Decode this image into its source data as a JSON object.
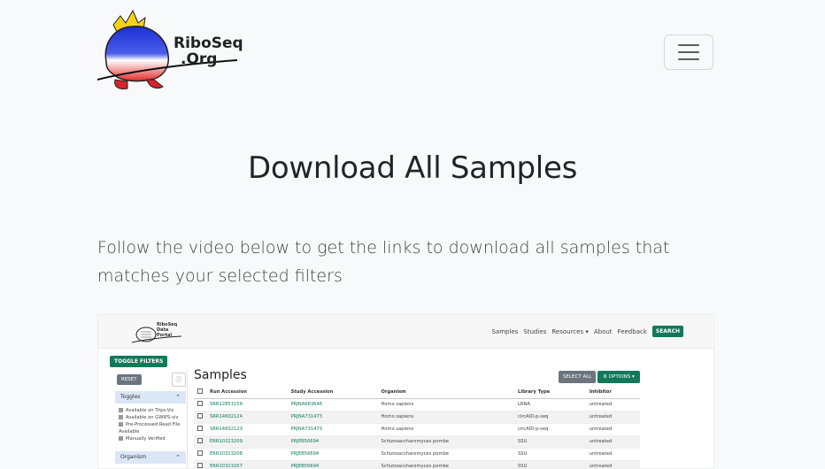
{
  "header": {
    "logo_line1": "RiboSeq",
    "logo_line2": ".Org",
    "menu_toggle_label": ""
  },
  "main": {
    "title": "Download All Samples",
    "intro": "Follow the video below to get the links to download all samples that matches your selected filters"
  },
  "video": {
    "logo_lines": [
      "RiboSeq",
      "Data",
      "Portal"
    ],
    "nav_links": [
      "Samples",
      "Studies",
      "Resources ▾",
      "About",
      "Feedback"
    ],
    "search_label": "SEARCH",
    "toggle_filters_label": "TOGGLE FILTERS",
    "reset_label": "RESET",
    "sections": [
      {
        "label": "Toggles",
        "options": [
          "Available on Trips-Viz",
          "Available on GWIPS-viz",
          "Pre-Processed Read File Available",
          "Manually Verified"
        ]
      },
      {
        "label": "Organism",
        "options": []
      }
    ],
    "samples_title": "Samples",
    "select_all_label": "SELECT ALL",
    "options_label": "⚙ OPTIONS ▾",
    "columns": [
      "",
      "Run Accession",
      "Study Accession",
      "Organism",
      "Library Type",
      "Inhibitor"
    ],
    "rows": [
      [
        "SRR12851159",
        "PRJNA663646",
        "Homo sapiens",
        "LRNA",
        "untreated"
      ],
      [
        "SRR14602124",
        "PRJNA731473",
        "Homo sapiens",
        "circAID-p-seq",
        "untreated"
      ],
      [
        "SRR14602123",
        "PRJNA731473",
        "Homo sapiens",
        "circAID-p-seq",
        "untreated"
      ],
      [
        "ERR10323209",
        "PRJEB56694",
        "Schizosaccharomyces pombe",
        "SSU",
        "untreated"
      ],
      [
        "ERR10323208",
        "PRJEB56694",
        "Schizosaccharomyces pombe",
        "SSU",
        "untreated"
      ],
      [
        "ERR10323207",
        "PRJEB56694",
        "Schizosaccharomyces pombe",
        "SSU",
        "untreated"
      ]
    ]
  },
  "colors": {
    "accent_green": "#11795a",
    "background": "#f8f9fb",
    "text": "#212529"
  }
}
